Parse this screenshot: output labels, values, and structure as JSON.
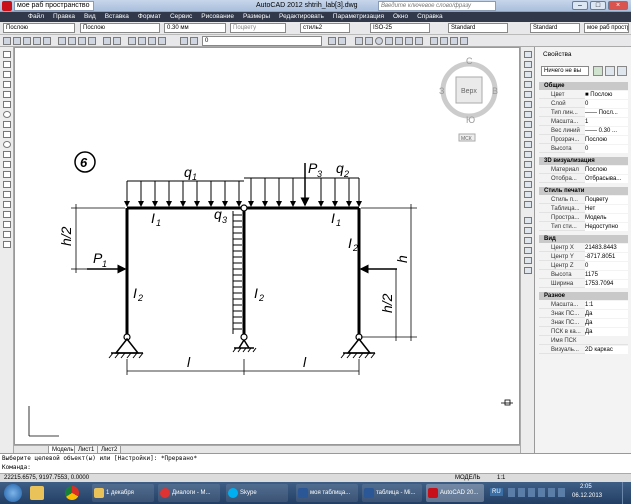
{
  "title_bar": {
    "tab1": "мое раб пространство",
    "app_title": "AutoCAD 2012  shtrih_lab[3].dwg",
    "search_placeholder": "Введите ключевое слово/фразу"
  },
  "menu": [
    "Файл",
    "Правка",
    "Вид",
    "Вставка",
    "Формат",
    "Сервис",
    "Рисование",
    "Размеры",
    "Редактировать",
    "Параметризация",
    "Окно",
    "Справка"
  ],
  "toolbar1": {
    "layer": "Послою",
    "linetype": "Послою",
    "lineweight": "0.30 мм",
    "plotstyle": "Поцвету",
    "textstyle": "стиль2",
    "dimstyle": "ISO-25",
    "tablestyle": "Standard",
    "mleaderstyle": "Standard",
    "workspace": "мое раб простр"
  },
  "toolbar2": {
    "layer_value": "0"
  },
  "viewcube": {
    "north": "С",
    "south": "Ю",
    "west": "З",
    "east": "В",
    "face": "Верх",
    "ucs": "МСК"
  },
  "drawing": {
    "problem_number": "6",
    "q1": "q",
    "q1_sub": "1",
    "q2": "q",
    "q2_sub": "2",
    "q3": "q",
    "q3_sub": "3",
    "P1": "P",
    "P1_sub": "1",
    "P3": "P",
    "P3_sub": "3",
    "I1a": "I",
    "I1a_sub": "1",
    "I1b": "I",
    "I1b_sub": "1",
    "I2a": "I",
    "I2a_sub": "2",
    "I2b": "I",
    "I2b_sub": "2",
    "I2c": "I",
    "I2c_sub": "2",
    "dim_h_left": "h/2",
    "dim_h_right": "h",
    "dim_h2_right": "h/2",
    "dim_l1": "l",
    "dim_l2": "l"
  },
  "properties": {
    "title": "Свойства",
    "selection": "Ничего не вы",
    "sections": [
      {
        "name": "Общие",
        "rows": [
          {
            "k": "Цвет",
            "v": "■ Послою"
          },
          {
            "k": "Слой",
            "v": "0"
          },
          {
            "k": "Тип лин...",
            "v": "—— Посл..."
          },
          {
            "k": "Масшта...",
            "v": "1"
          },
          {
            "k": "Вес линий",
            "v": "—— 0.30 ..."
          },
          {
            "k": "Прозрач...",
            "v": "Послою"
          },
          {
            "k": "Высота",
            "v": "0"
          }
        ]
      },
      {
        "name": "3D визуализация",
        "rows": [
          {
            "k": "Материал",
            "v": "Послою"
          },
          {
            "k": "Отобра...",
            "v": "Отбрасыва..."
          }
        ]
      },
      {
        "name": "Стиль печати",
        "rows": [
          {
            "k": "Стиль п...",
            "v": "Поцвету"
          },
          {
            "k": "Таблица...",
            "v": "Нет"
          },
          {
            "k": "Простра...",
            "v": "Модель"
          },
          {
            "k": "Тип сти...",
            "v": "Недоступно"
          }
        ]
      },
      {
        "name": "Вид",
        "rows": [
          {
            "k": "Центр X",
            "v": "21483.8443"
          },
          {
            "k": "Центр Y",
            "v": "-8717.8051"
          },
          {
            "k": "Центр Z",
            "v": "0"
          },
          {
            "k": "Высота",
            "v": "1175"
          },
          {
            "k": "Ширина",
            "v": "1753.7094"
          }
        ]
      },
      {
        "name": "Разное",
        "rows": [
          {
            "k": "Масшта...",
            "v": "1:1"
          },
          {
            "k": "Знак ПС...",
            "v": "Да"
          },
          {
            "k": "Знак ПС...",
            "v": "Да"
          },
          {
            "k": "ПСК в ка...",
            "v": "Да"
          },
          {
            "k": "Имя ПСК",
            "v": ""
          },
          {
            "k": "Визуаль...",
            "v": "2D каркас"
          }
        ]
      }
    ]
  },
  "layout_tabs": [
    "Модель",
    "Лист1",
    "Лист2"
  ],
  "command": {
    "history": "Выберите целевой объект(ы) или [Настройки]: *Прервано*",
    "prompt": "Команда:"
  },
  "status": {
    "coords": "22215.6575, 9197.7553, 0.0000",
    "model": "МОДЕЛЬ",
    "scale": "1:1"
  },
  "taskbar": {
    "items": [
      "1 декабря",
      "Диалоги - М...",
      "Skype",
      "моя таблица...",
      "таблица - Mi...",
      "AutoCAD 20..."
    ],
    "lang": "RU",
    "time": "2:05",
    "date": "06.12.2013"
  },
  "colors": {
    "accent": "#30384a",
    "taskbar": "#2b4a75",
    "autocad_red": "#c8101a"
  }
}
